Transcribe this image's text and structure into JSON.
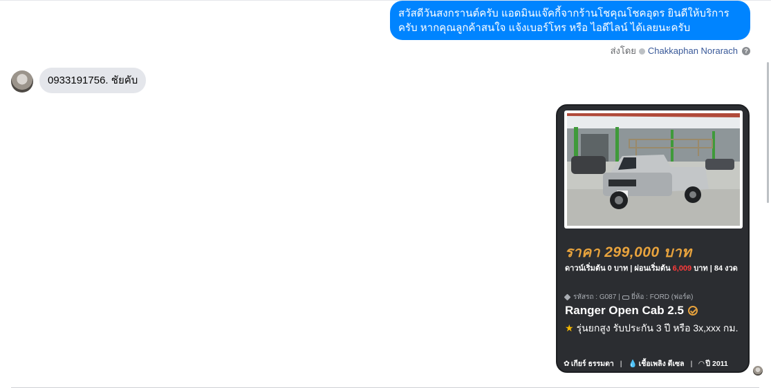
{
  "messages": {
    "outgoing_text": "สวัสดีวันสงกรานต์ครับ แอดมินแจ๊คกี้จากร้านโชคุณโชคอุดร ยินดีให้บริการครับ หากคุณลูกค้าสนใจ แจ้งเบอร์โทร หรือ ไอดีไลน์ ได้เลยนะครับ",
    "sent_by_label": "ส่งโดย",
    "sent_by_name": "Chakkaphan Norarach",
    "incoming_text": "0933191756.   ชัยคับ"
  },
  "listing": {
    "price": "ราคา 299,000 บาท",
    "finance_prefix": "ดาวน์เริ่มต้น 0 บาท | ผ่อนเริ่มต้น ",
    "finance_monthly": "6,009",
    "finance_suffix": " บาท | 84 งวด",
    "code": "รหัสรถ : G087",
    "brand": "ยี่ห้อ : FORD (ฟอร์ด)",
    "model": "Ranger Open Cab 2.5",
    "description": "รุ่นยกสูง รับประกัน 3 ปี หรือ 3x,xxx กม.",
    "gear": "เกียร์ ธรรมดา",
    "fuel": "เชื้อเพลิง ดีเซล",
    "year": "ปี 2011",
    "separator": "|"
  },
  "colors": {
    "outgoing_bubble": "#0084ff",
    "incoming_bubble": "#e4e6eb",
    "card_bg": "#2b2d31",
    "price": "#e8a33d",
    "monthly_highlight": "#ff3b3b",
    "star": "#f5b800"
  },
  "icons": [
    "help-icon",
    "tag-icon",
    "car-icon",
    "verified-check-icon",
    "star-icon",
    "gear-icon",
    "fuel-icon",
    "speedometer-icon"
  ]
}
